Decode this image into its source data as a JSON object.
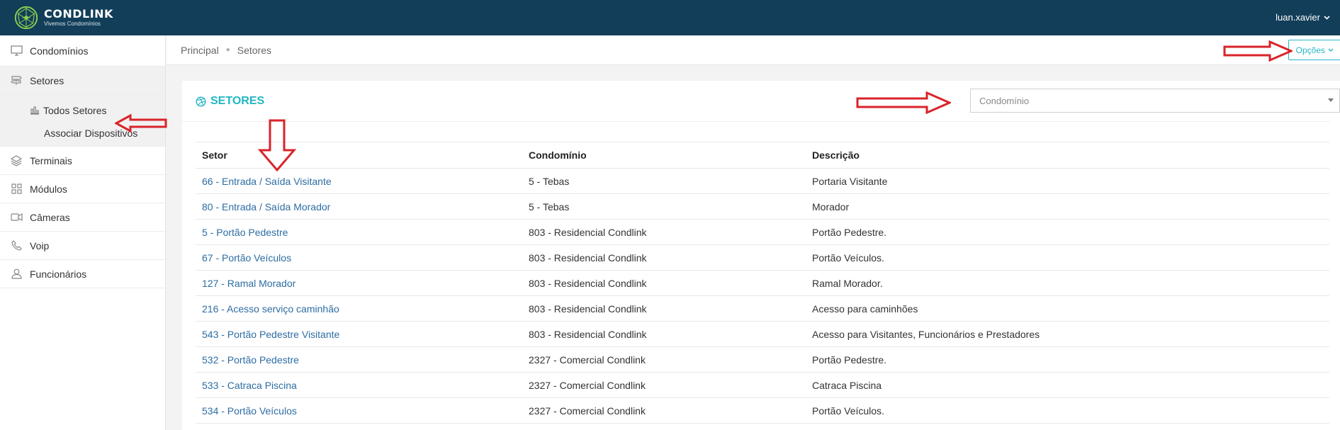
{
  "header": {
    "brand_name": "CONDLINK",
    "brand_tagline": "Vivemos Condomínios",
    "user_name": "luan.xavier"
  },
  "sidebar": {
    "items": [
      {
        "label": "Condomínios",
        "icon": "monitor-icon"
      },
      {
        "label": "Setores",
        "icon": "signpost-icon"
      },
      {
        "label": "Terminais",
        "icon": "layers-icon"
      },
      {
        "label": "Módulos",
        "icon": "grid-icon"
      },
      {
        "label": "Câmeras",
        "icon": "video-camera-icon"
      },
      {
        "label": "Voip",
        "icon": "phone-icon"
      },
      {
        "label": "Funcionários",
        "icon": "user-icon"
      }
    ],
    "setores_submenu": [
      {
        "label": "Todos Setores",
        "icon": "bar-chart-icon"
      },
      {
        "label": "Associar Dispositivos"
      }
    ]
  },
  "breadcrumb": {
    "items": [
      "Principal",
      "Setores"
    ],
    "options_label": "Opções"
  },
  "panel": {
    "title": "SETORES",
    "condominio_select_placeholder": "Condomínio",
    "table": {
      "headers": [
        "Setor",
        "Condomínio",
        "Descrição"
      ],
      "rows": [
        [
          "66 - Entrada / Saída Visitante",
          "5 - Tebas",
          "Portaria Visitante"
        ],
        [
          "80 - Entrada / Saída Morador",
          "5 - Tebas",
          "Morador"
        ],
        [
          "5 - Portão Pedestre",
          "803 - Residencial Condlink",
          "Portão Pedestre."
        ],
        [
          "67 - Portão Veículos",
          "803 - Residencial Condlink",
          "Portão Veículos."
        ],
        [
          "127 - Ramal Morador",
          "803 - Residencial Condlink",
          "Ramal Morador."
        ],
        [
          "216 - Acesso serviço caminhão",
          "803 - Residencial Condlink",
          "Acesso para caminhões"
        ],
        [
          "543 - Portão Pedestre Visitante",
          "803 - Residencial Condlink",
          "Acesso para Visitantes, Funcionários e Prestadores"
        ],
        [
          "532 - Portão Pedestre",
          "2327 - Comercial Condlink",
          "Portão Pedestre."
        ],
        [
          "533 - Catraca Piscina",
          "2327 - Comercial Condlink",
          "Catraca Piscina"
        ],
        [
          "534 - Portão Veículos",
          "2327 - Comercial Condlink",
          "Portão Veículos."
        ]
      ]
    }
  },
  "colors": {
    "topbar": "#123e59",
    "accent": "#23b5c4",
    "link": "#2d6da3",
    "annotation_arrow": "#d9232a"
  }
}
